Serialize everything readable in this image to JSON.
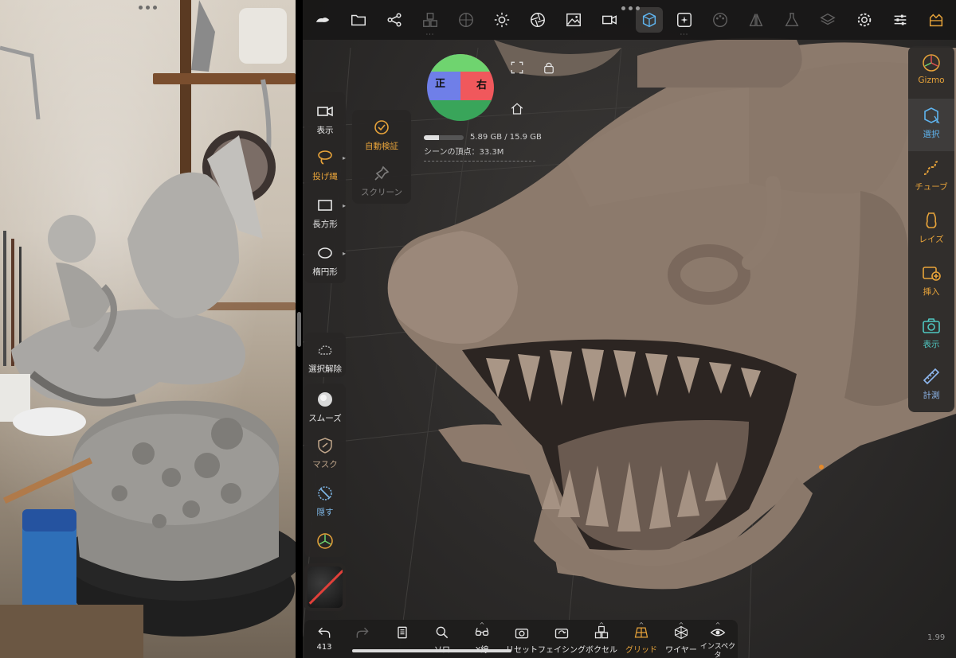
{
  "photo_pane": {
    "pane_menu_dots": "•••"
  },
  "app": {
    "top_dots": "•••"
  },
  "top_toolbar": {
    "icons": [
      "cloud-icon",
      "folder-icon",
      "scene-graph-icon",
      "cubes-icon",
      "sphere-grid-icon",
      "sun-icon",
      "aperture-icon",
      "image-icon",
      "video-camera-icon",
      "selection-cube-icon",
      "sparkle-square-icon",
      "palette-icon",
      "symmetry-icon",
      "flask-icon",
      "layers-icon",
      "gear-icon",
      "sliders-icon",
      "crown-box-icon"
    ]
  },
  "view_gizmo": {
    "front_label": "正",
    "right_label": "右"
  },
  "viewport": {
    "memory_text": "5.89 GB / 15.9 GB",
    "memory_fraction": 0.37,
    "vertex_text": "シーンの頂点：33.3M",
    "version": "1.99"
  },
  "left_tools": {
    "view_label": "表示",
    "lasso_label": "投げ縄",
    "rectangle_label": "長方形",
    "ellipse_label": "楕円形",
    "auto_validate_label": "自動検証",
    "screen_label": "スクリーン",
    "deselect_label": "選択解除",
    "smooth_label": "スムーズ",
    "mask_label": "マスク",
    "hide_label": "隠す"
  },
  "right_panel": {
    "gizmo_label": "Gizmo",
    "select_label": "選択",
    "tube_label": "チューブ",
    "lathe_label": "レイズ",
    "insert_label": "挿入",
    "view_label": "表示",
    "measure_label": "計測"
  },
  "bottom_toolbar": {
    "undo_count": "413",
    "items": [
      "ソロ",
      "X線",
      "リセット",
      "フェイシング",
      "ボクセル",
      "グリッド",
      "ワイヤー",
      "インスペクタ"
    ]
  },
  "colors": {
    "accent_orange": "#e7a33a",
    "active_blue": "#5fb4ef",
    "active_teal": "#4fc6c0"
  }
}
